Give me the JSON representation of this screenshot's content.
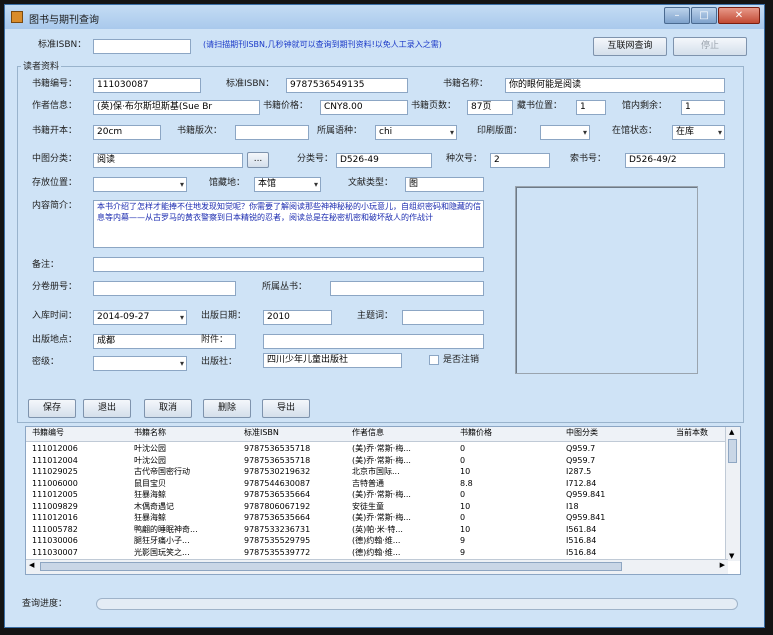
{
  "window": {
    "title": "图书与期刊查询",
    "controls": {
      "minimize": "–",
      "maximize": "□",
      "close": "✕"
    }
  },
  "top": {
    "isbn_label": "标准ISBN：",
    "isbn_value": "",
    "hint": "(请扫描期刊ISBN,几秒钟就可以查询到期刊资料!以免人工录入之需)",
    "query_button": "互联网查询",
    "stop_button": "停止"
  },
  "group_title": "读者资料",
  "form": {
    "book_no": {
      "label": "书籍编号：",
      "value": "111030087"
    },
    "isbn": {
      "label": "标准ISBN：",
      "value": "9787536549135"
    },
    "book_name": {
      "label": "书籍名称：",
      "value": "你的眼何能是阅读"
    },
    "author": {
      "label": "作者信息：",
      "value": "(英)保·布尔斯坦斯基(Sue Br"
    },
    "price": {
      "label": "书籍价格：",
      "value": "CNY8.00"
    },
    "pages": {
      "label": "书籍页数：",
      "value": "87页"
    },
    "shelf_pos": {
      "label": "藏书位置：",
      "value": "1"
    },
    "stock": {
      "label": "馆内剩余：",
      "value": "1"
    },
    "format": {
      "label": "书籍开本：",
      "value": "20cm"
    },
    "edition": {
      "label": "书籍版次：",
      "value": ""
    },
    "language": {
      "label": "所属语种：",
      "value": "chi"
    },
    "print_face": {
      "label": "印刷版面：",
      "value": ""
    },
    "status": {
      "label": "在馆状态：",
      "value": "在库"
    },
    "cn_class": {
      "label": "中图分类：",
      "value": "阅读",
      "browse": "..."
    },
    "class_no": {
      "label": "分类号：",
      "value": "D526-49"
    },
    "type_no": {
      "label": "种次号：",
      "value": "2"
    },
    "call_no": {
      "label": "索书号：",
      "value": "D526-49/2"
    },
    "location": {
      "label": "存放位置：",
      "value": ""
    },
    "collection": {
      "label": "馆藏地：",
      "value": "本馆"
    },
    "doc_type": {
      "label": "文献类型：",
      "value": "图"
    },
    "summary": {
      "label": "内容简介：",
      "value": "本书介绍了怎样才能捧不住地发现知觉呢？你需要了解阅读那些神神秘秘的小玩意儿，自组织密码和隐藏的信息等内幕——从古罗马的黄衣警察到日本精锐的忍者，阅读总是在秘密机密和破坏敌人的作战计"
    },
    "notes": {
      "label": "备注：",
      "value": ""
    },
    "volume_no": {
      "label": "分卷册号：",
      "value": ""
    },
    "series": {
      "label": "所属丛书：",
      "value": ""
    },
    "in_date": {
      "label": "入库时间：",
      "value": "2014-09-27"
    },
    "pub_date": {
      "label": "出版日期：",
      "value": "2010"
    },
    "keywords": {
      "label": "主题词：",
      "value": ""
    },
    "pub_place": {
      "label": "出版地点：",
      "value": "成都"
    },
    "attachment": {
      "label": "附件：",
      "value": ""
    },
    "secret": {
      "label": "密级：",
      "value": ""
    },
    "publisher": {
      "label": "出版社：",
      "value": "四川少年儿童出版社"
    },
    "cancel_chk": {
      "label": "是否注销"
    }
  },
  "buttons": {
    "save": "保存",
    "exit": "退出",
    "cancel": "取消",
    "delete": "删除",
    "export": "导出"
  },
  "table": {
    "headers": [
      "书籍编号",
      "书籍名称",
      "标准ISBN",
      "作者信息",
      "书籍价格",
      "中图分类",
      "当前本数"
    ],
    "rows": [
      [
        "111012006",
        "叶沈公园",
        "9787536535718",
        "(美)乔·常斯·梅...",
        "0",
        "Q959.7",
        ""
      ],
      [
        "111012004",
        "叶沈公园",
        "9787536535718",
        "(美)乔·常斯·梅...",
        "0",
        "Q959.7",
        ""
      ],
      [
        "111029025",
        "古代帝国密行动",
        "9787530219632",
        "北京市国际...",
        "10",
        "I287.5",
        ""
      ],
      [
        "111006000",
        "鼠目宝贝",
        "9787544630087",
        "吉特普通",
        "8.8",
        "I712.84",
        ""
      ],
      [
        "111012005",
        "狂暴海鲸",
        "9787536535664",
        "(美)乔·常斯·梅...",
        "0",
        "Q959.841",
        ""
      ],
      [
        "111009829",
        "木偶奇遇记",
        "9787806067192",
        "安徒生童",
        "10",
        "I18",
        ""
      ],
      [
        "111012016",
        "狂暴海鲸",
        "9787536535664",
        "(美)乔·常斯·梅...",
        "0",
        "Q959.841",
        ""
      ],
      [
        "111005782",
        "鸭翩的睡眠神奇...",
        "9787533236731",
        "(英)帕·米·特...",
        "10",
        "I561.84",
        ""
      ],
      [
        "111030006",
        "腿狂牙痛小子...",
        "9787535529795",
        "(德)约翰·维...",
        "9",
        "I516.84",
        ""
      ],
      [
        "111030007",
        "光影国玩笑之...",
        "9787535539772",
        "(德)约翰·维...",
        "9",
        "I516.84",
        ""
      ]
    ]
  },
  "status": {
    "label": "查询进度："
  }
}
